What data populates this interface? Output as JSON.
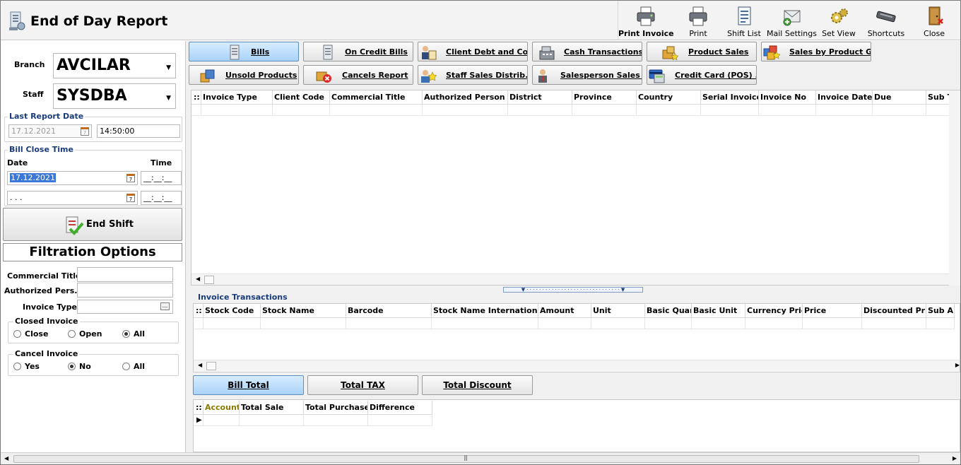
{
  "window": {
    "title": "End of Day Report"
  },
  "toolbar": {
    "items": [
      {
        "label": "Print Invoice",
        "icon": "printer-icon",
        "bold": true
      },
      {
        "label": "Print",
        "icon": "printer-icon"
      },
      {
        "label": "Shift List",
        "icon": "list-document-icon"
      },
      {
        "label": "Mail Settings",
        "icon": "mail-settings-icon"
      },
      {
        "label": "Set View",
        "icon": "gears-icon"
      },
      {
        "label": "Shortcuts",
        "icon": "keyboard-icon"
      },
      {
        "label": "Close",
        "icon": "exit-door-icon"
      }
    ]
  },
  "left": {
    "branch_label": "Branch",
    "branch_value": "AVCILAR",
    "staff_label": "Staff",
    "staff_value": "SYSDBA",
    "last_report": {
      "title": "Last Report Date",
      "date": "17.12.2021",
      "time": "14:50:00"
    },
    "bill_close": {
      "title": "Bill Close Time",
      "date_label": "Date",
      "time_label": "Time",
      "date_from": "17.12.2021",
      "time_from": "__:__:__",
      "date_to": ". . .",
      "time_to": "__:__:__"
    },
    "end_shift_label": "End Shift",
    "filtration": {
      "title": "Filtration Options",
      "commercial_title_label": "Commercial Title",
      "commercial_title_value": "",
      "authorized_person_label": "Authorized Pers...",
      "authorized_person_value": "",
      "invoice_type_label": "Invoice Type",
      "invoice_type_value": "",
      "invoice_type_btn": "...",
      "closed_invoice": {
        "title": "Closed Invoice",
        "options": [
          "Close",
          "Open",
          "All"
        ],
        "selected": "All"
      },
      "cancel_invoice": {
        "title": "Cancel Invoice",
        "options": [
          "Yes",
          "No",
          "All"
        ],
        "selected": "No"
      }
    }
  },
  "report_buttons": {
    "row1": [
      {
        "label": "Bills",
        "active": true,
        "icon": "bills-icon"
      },
      {
        "label": "On Credit Bills",
        "icon": "credit-bills-icon"
      },
      {
        "label": "Client Debt and Col...",
        "icon": "client-debt-icon"
      },
      {
        "label": "Cash Transactions",
        "icon": "cash-register-icon"
      },
      {
        "label": "Product Sales",
        "icon": "product-sales-icon"
      },
      {
        "label": "Sales by Product G...",
        "icon": "product-group-icon"
      }
    ],
    "row2": [
      {
        "label": "Unsold Products",
        "icon": "unsold-products-icon"
      },
      {
        "label": "Cancels Report",
        "icon": "cancel-report-icon"
      },
      {
        "label": "Staff Sales Distrib...",
        "icon": "staff-sales-icon"
      },
      {
        "label": "Salesperson Sales ...",
        "icon": "salesperson-icon"
      },
      {
        "label": "Credit Card (POS) ...",
        "icon": "credit-card-icon"
      }
    ]
  },
  "invoice_grid": {
    "indicator": "::",
    "columns": [
      "Invoice Type",
      "Client Code",
      "Commercial Title",
      "Authorized Person",
      "District",
      "Province",
      "Country",
      "Serial Invoice",
      "Invoice No",
      "Invoice Date",
      "Due",
      "Sub T"
    ]
  },
  "transactions": {
    "title": "Invoice Transactions",
    "indicator": "::",
    "columns": [
      "Stock Code",
      "Stock Name",
      "Barcode",
      "Stock Name International",
      "Amount",
      "Unit",
      "Basic Quan",
      "Basic Unit",
      "Currency Pric",
      "Price",
      "Discounted Pric",
      "Sub A"
    ]
  },
  "total_tabs": [
    {
      "label": "Bill Total",
      "active": true
    },
    {
      "label": "Total TAX"
    },
    {
      "label": "Total Discount"
    }
  ],
  "totals_grid": {
    "indicator": "::",
    "columns": [
      "Account",
      "Total Sale",
      "Total Purchase",
      "Difference"
    ],
    "highlight_color": "#8a7a00"
  },
  "colors": {
    "active_button": "#a9d3f9",
    "section_title": "#1a3c7a",
    "selection": "#3a78d8"
  }
}
